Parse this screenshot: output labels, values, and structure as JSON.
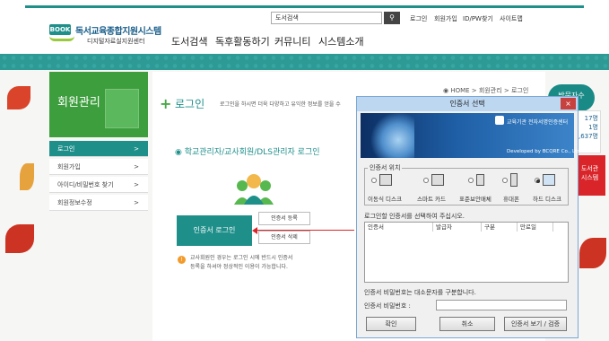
{
  "header": {
    "logo_badge": "BOOK",
    "logo_title": "독서교육종합지원시스템",
    "logo_sub": "디지털자료실지원센터",
    "search_value": "도서검색",
    "utility_links": [
      "로그인",
      "회원가입",
      "ID/PW찾기",
      "사이트맵"
    ],
    "gnb": [
      "도서검색",
      "독후활동하기",
      "커뮤니티",
      "시스템소개"
    ]
  },
  "sidebar": {
    "title": "회원관리",
    "items": [
      {
        "label": "로그인",
        "arrow": ">"
      },
      {
        "label": "회원가입",
        "arrow": ">"
      },
      {
        "label": "아이디/비밀번호 찾기",
        "arrow": ">"
      },
      {
        "label": "회원정보수정",
        "arrow": ">"
      }
    ]
  },
  "content": {
    "plus": "+",
    "title": "로그인",
    "desc": "로그인을 하시면 더욱 다양하고 유익한 정보를 얻을 수",
    "breadcrumb": "HOME > 회원관리 > 로그인",
    "section_title": "학교관리자/교사회원/DLS관리자 로그인",
    "login_button": "인증서 로그인",
    "register_button": "인증서 등록",
    "delete_button": "인증서 삭제",
    "notice_line1": "교사회원인 경우는 로그인 시에 반드시 인증서",
    "notice_line2": "등록을 하셔야 정상적인 이용이 가능합니다."
  },
  "right_panel": {
    "circle_label": "방문자수",
    "stats": [
      "17명",
      "1명",
      "3,637명"
    ],
    "red_banner": "도서관\n시스템"
  },
  "dialog": {
    "title": "인증서 선택",
    "close": "×",
    "banner_text": "교육기관 전자서명인증센터",
    "banner_dev": "Developed by BCQRE Co., Ltd",
    "location_label": "인증서 위치",
    "locations": [
      {
        "name": "이동식 디스크",
        "selected": false
      },
      {
        "name": "스마트 카드",
        "selected": false
      },
      {
        "name": "표준보안매체",
        "selected": false
      },
      {
        "name": "휴대폰",
        "selected": false
      },
      {
        "name": "하드 디스크",
        "selected": true
      }
    ],
    "select_text": "로그인할 인증서를 선택하여 주십시오.",
    "columns": [
      "인증서",
      "발급자",
      "구분",
      "만료일"
    ],
    "pw_hint": "인증서 비밀번호는 대소문자를 구분합니다.",
    "pw_label": "인증서 비밀번호 :",
    "ok_button": "확인",
    "cancel_button": "취소",
    "view_button": "인증서 보기 / 검증"
  }
}
